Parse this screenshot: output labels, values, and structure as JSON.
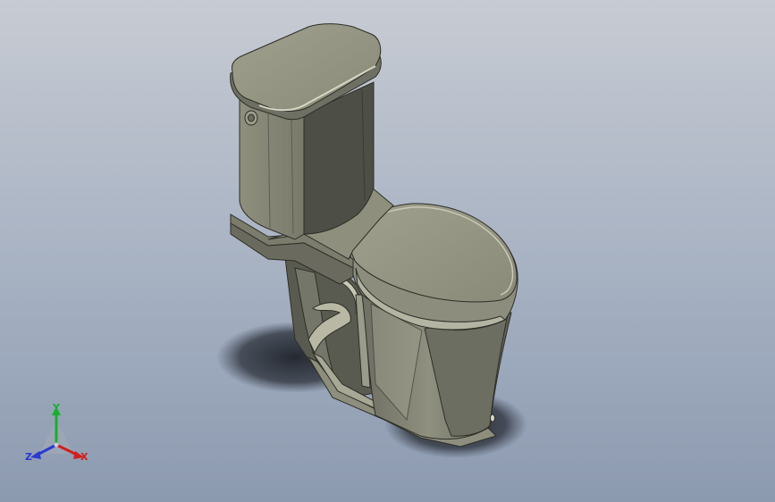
{
  "viewport": {
    "model": "toilet",
    "background": {
      "top": "#c7cbd3",
      "bottom": "#8c9ab0"
    }
  },
  "triad": {
    "x_label": "X",
    "y_label": "Y",
    "z_label": "Z",
    "x_color": "#d21e1e",
    "y_color": "#16b02a",
    "z_color": "#2a3ad0"
  }
}
